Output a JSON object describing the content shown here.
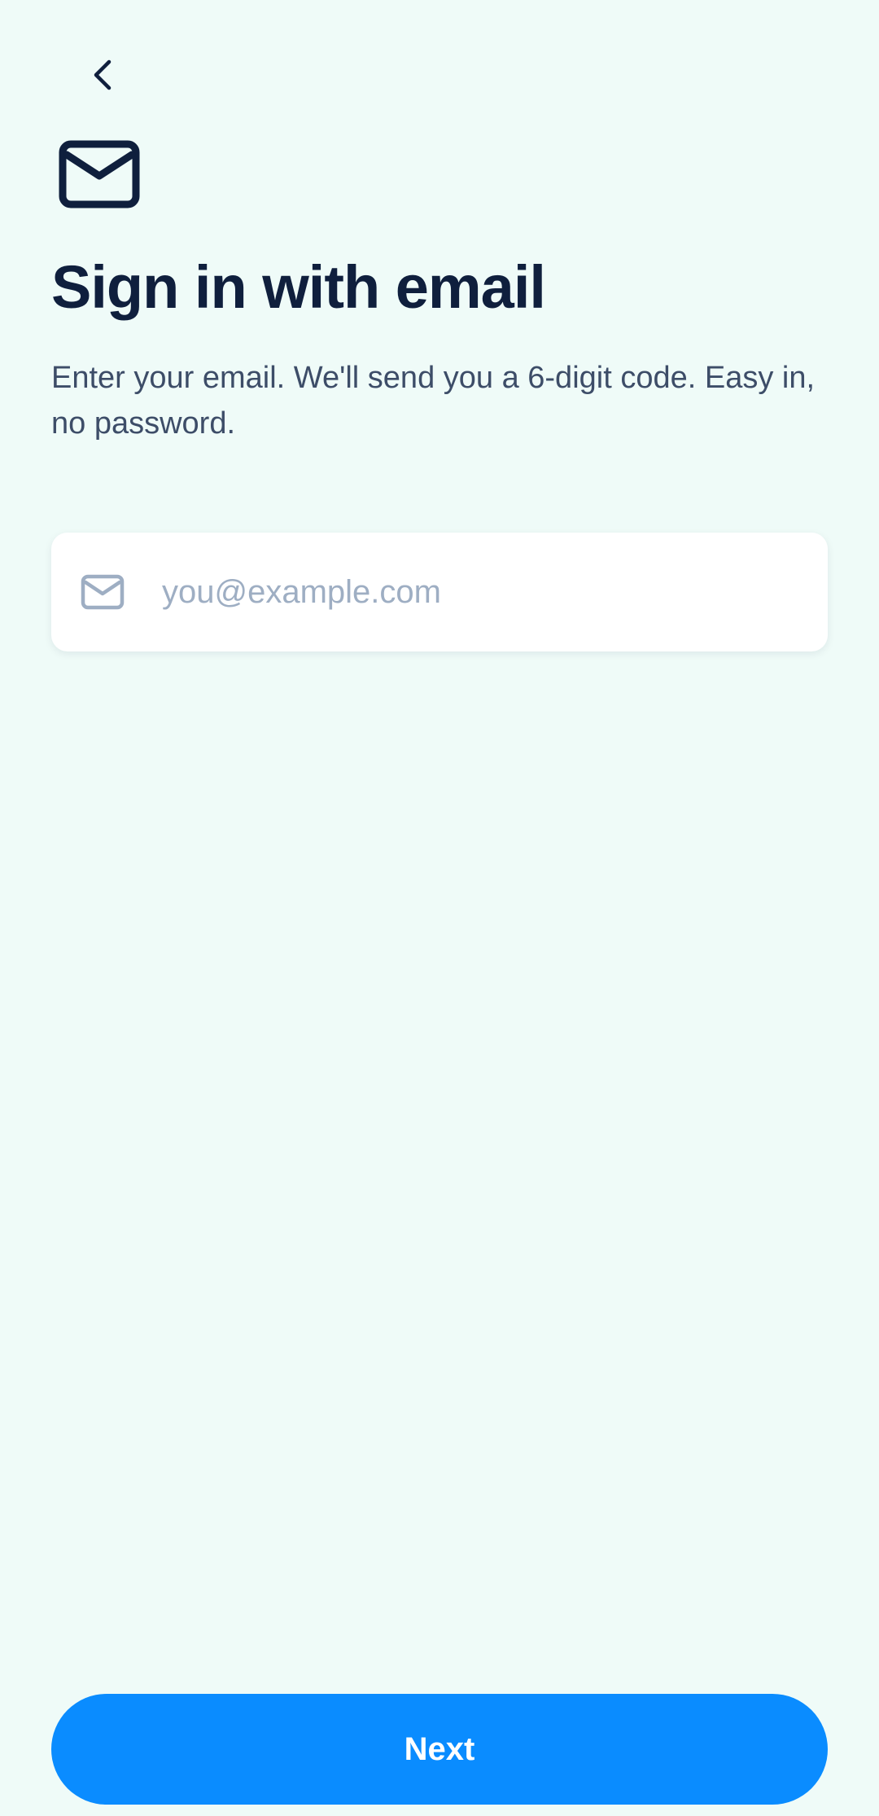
{
  "header": {
    "back_icon": "chevron-left-icon"
  },
  "hero": {
    "icon": "mail-icon",
    "title": "Sign in with email",
    "subtitle": "Enter your email. We'll send you a 6-digit code. Easy in, no password."
  },
  "email_field": {
    "icon": "mail-icon",
    "value": "",
    "placeholder": "you@example.com"
  },
  "actions": {
    "next_label": "Next"
  },
  "colors": {
    "background": "#effbf8",
    "primary": "#0a8cff",
    "title_text": "#0f1f3d",
    "body_text": "#3d4d68",
    "placeholder_text": "#9eaec3"
  }
}
